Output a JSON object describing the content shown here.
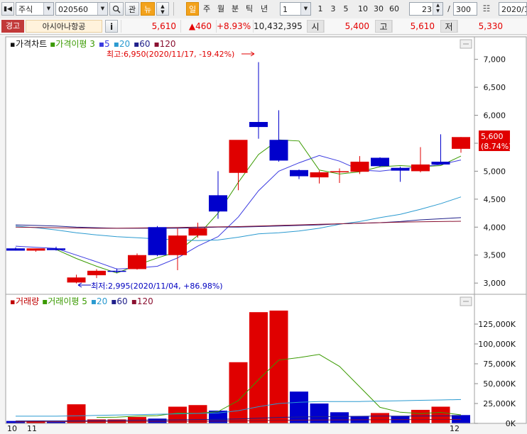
{
  "toolbar": {
    "market": "주식",
    "code": "020560",
    "btn_gwan": "관",
    "btn_new": "뉴",
    "period_tabs": [
      "일",
      "주",
      "월",
      "분",
      "틱",
      "년"
    ],
    "interval_value": "1",
    "quick_intervals": [
      "1",
      "3",
      "5",
      "10",
      "30",
      "60"
    ],
    "count_value": "23",
    "count_total": "300",
    "date_value": "2020/1"
  },
  "infobar": {
    "badge": "경고",
    "name": "아시아나항공",
    "info_btn": "i",
    "price": "5,610",
    "change": "▲460",
    "change_pct": "+8.93%",
    "volume": "10,432,395",
    "open_label": "시",
    "open": "5,400",
    "high_label": "고",
    "high": "5,610",
    "low_label": "저",
    "low": "5,330"
  },
  "colors": {
    "up": "#e00000",
    "down": "#0000cc",
    "ma3": "#3a9a00",
    "ma5": "#3a3ae0",
    "ma20": "#2a9ad0",
    "ma60": "#20208a",
    "ma120": "#8a1030"
  },
  "chart_data": [
    {
      "type": "candlestick",
      "title": "가격차트",
      "legend": [
        {
          "name": "가격이평 3",
          "color": "#3a9a00"
        },
        {
          "name": "5",
          "color": "#3a3ae0"
        },
        {
          "name": "20",
          "color": "#2a9ad0"
        },
        {
          "name": "60",
          "color": "#20208a"
        },
        {
          "name": "120",
          "color": "#8a1030"
        }
      ],
      "ylim": [
        2850,
        7300
      ],
      "yticks": [
        3000,
        3500,
        4000,
        4500,
        5000,
        5500,
        6000,
        6500,
        7000
      ],
      "ytick_labels": [
        "3,000",
        "3,500",
        "4,000",
        "4,500",
        "5,000",
        "5,500",
        "6,000",
        "6,500",
        "7,000"
      ],
      "candles": [
        {
          "o": 3620,
          "h": 3640,
          "l": 3580,
          "c": 3580
        },
        {
          "o": 3580,
          "h": 3610,
          "l": 3560,
          "c": 3620
        },
        {
          "o": 3620,
          "h": 3650,
          "l": 3580,
          "c": 3590
        },
        {
          "o": 3010,
          "h": 3150,
          "l": 2995,
          "c": 3100
        },
        {
          "o": 3140,
          "h": 3250,
          "l": 3090,
          "c": 3220
        },
        {
          "o": 3220,
          "h": 3260,
          "l": 3180,
          "c": 3210
        },
        {
          "o": 3250,
          "h": 3530,
          "l": 3240,
          "c": 3500
        },
        {
          "o": 4000,
          "h": 4020,
          "l": 3480,
          "c": 3500
        },
        {
          "o": 3500,
          "h": 3980,
          "l": 3230,
          "c": 3850
        },
        {
          "o": 3850,
          "h": 4080,
          "l": 3810,
          "c": 3980
        },
        {
          "o": 4570,
          "h": 5000,
          "l": 4150,
          "c": 4280
        },
        {
          "o": 4970,
          "h": 5550,
          "l": 4660,
          "c": 5560
        },
        {
          "o": 5880,
          "h": 6950,
          "l": 5580,
          "c": 5790
        },
        {
          "o": 5560,
          "h": 6090,
          "l": 5170,
          "c": 5190
        },
        {
          "o": 5020,
          "h": 5030,
          "l": 4860,
          "c": 4910
        },
        {
          "o": 4890,
          "h": 5010,
          "l": 4780,
          "c": 4980
        },
        {
          "o": 5000,
          "h": 5050,
          "l": 4790,
          "c": 5000
        },
        {
          "o": 4990,
          "h": 5270,
          "l": 4950,
          "c": 5170
        },
        {
          "o": 5240,
          "h": 5250,
          "l": 5080,
          "c": 5090
        },
        {
          "o": 5060,
          "h": 5080,
          "l": 4810,
          "c": 5010
        },
        {
          "o": 5000,
          "h": 5430,
          "l": 4980,
          "c": 5120
        },
        {
          "o": 5170,
          "h": 5660,
          "l": 5120,
          "c": 5120
        },
        {
          "o": 5400,
          "h": 5610,
          "l": 5330,
          "c": 5610
        }
      ],
      "ma_series": [
        {
          "name": "3",
          "color": "#3a9a00",
          "values": [
            null,
            null,
            3600,
            3440,
            3300,
            3180,
            3320,
            3450,
            3560,
            3850,
            4250,
            4800,
            5300,
            5560,
            5540,
            5020,
            4950,
            4990,
            5080,
            5100,
            5080,
            5100,
            5270
          ]
        },
        {
          "name": "5",
          "color": "#3a3ae0",
          "values": [
            3660,
            3640,
            3620,
            3500,
            3380,
            3250,
            3270,
            3300,
            3450,
            3660,
            3830,
            4180,
            4650,
            5000,
            5150,
            5280,
            5180,
            5020,
            5000,
            5040,
            5080,
            5120,
            5200
          ]
        },
        {
          "name": "20",
          "color": "#2a9ad0",
          "values": [
            4020,
            3990,
            3950,
            3900,
            3860,
            3830,
            3810,
            3790,
            3770,
            3760,
            3770,
            3820,
            3880,
            3900,
            3930,
            3980,
            4050,
            4100,
            4170,
            4230,
            4320,
            4420,
            4540
          ]
        },
        {
          "name": "60",
          "color": "#20208a",
          "values": [
            4040,
            4030,
            4020,
            4000,
            3990,
            3980,
            3980,
            3980,
            3980,
            3990,
            4000,
            4000,
            4010,
            4020,
            4030,
            4040,
            4060,
            4070,
            4080,
            4100,
            4130,
            4150,
            4170
          ]
        },
        {
          "name": "120",
          "color": "#8a1030",
          "values": [
            4000,
            3995,
            3990,
            3985,
            3980,
            3980,
            3985,
            3990,
            3995,
            4000,
            4005,
            4010,
            4020,
            4030,
            4040,
            4050,
            4060,
            4070,
            4080,
            4090,
            4095,
            4100,
            4105
          ]
        }
      ],
      "annotations": {
        "high": "최고:6,950(2020/11/17, -19.42%)",
        "low": "최저:2,995(2020/11/04, +86.98%)"
      },
      "last_price_label": "5,600",
      "last_pct_label": "(8.74%)"
    },
    {
      "type": "bar",
      "title": "거래량",
      "legend": [
        {
          "name": "거래이평 5",
          "color": "#3a9a00"
        },
        {
          "name": "20",
          "color": "#2a9ad0"
        },
        {
          "name": "60",
          "color": "#20208a"
        },
        {
          "name": "120",
          "color": "#8a1030"
        }
      ],
      "ylim": [
        0,
        150000
      ],
      "yticks": [
        0,
        25000,
        50000,
        75000,
        100000,
        125000
      ],
      "ytick_labels": [
        "0K",
        "25,000K",
        "50,000K",
        "75,000K",
        "100,000K",
        "125,000K"
      ],
      "values": [
        3000,
        3000,
        2500,
        24000,
        5000,
        5000,
        8000,
        6000,
        21000,
        23000,
        16000,
        77000,
        140000,
        142000,
        40000,
        25000,
        14000,
        9000,
        13000,
        9000,
        17000,
        21000,
        10432
      ],
      "bar_up": [
        false,
        true,
        false,
        true,
        true,
        true,
        true,
        false,
        true,
        true,
        false,
        true,
        true,
        true,
        false,
        false,
        false,
        false,
        true,
        false,
        true,
        true,
        false
      ],
      "ma_series": [
        {
          "name": "5",
          "color": "#3a9a00",
          "values": [
            null,
            null,
            null,
            null,
            7500,
            7900,
            9100,
            9700,
            13000,
            12600,
            14800,
            28700,
            55000,
            79600,
            82900,
            86800,
            71700,
            46000,
            20200,
            14000,
            12400,
            13800,
            10700
          ]
        },
        {
          "name": "20",
          "color": "#2a9ad0",
          "values": [
            9000,
            9000,
            9000,
            9500,
            10000,
            10500,
            11000,
            11500,
            12000,
            12500,
            13000,
            16000,
            21000,
            25000,
            26500,
            27500,
            27500,
            27500,
            28000,
            28500,
            29000,
            29500,
            30000
          ]
        },
        {
          "name": "60",
          "color": "#20208a",
          "values": [
            3000,
            3100,
            3200,
            3400,
            3600,
            3800,
            4000,
            4200,
            4500,
            4800,
            5000,
            5500,
            6500,
            7500,
            8000,
            8500,
            8700,
            8900,
            9100,
            9200,
            9300,
            9400,
            9500
          ]
        },
        {
          "name": "120",
          "color": "#8a1030",
          "values": [
            2000,
            2050,
            2100,
            2200,
            2300,
            2400,
            2500,
            2600,
            2700,
            2800,
            2900,
            3100,
            3500,
            3900,
            4100,
            4300,
            4400,
            4500,
            4600,
            4700,
            4800,
            4900,
            5000
          ]
        }
      ]
    }
  ],
  "x_labels": [
    "10",
    "11",
    "12"
  ]
}
